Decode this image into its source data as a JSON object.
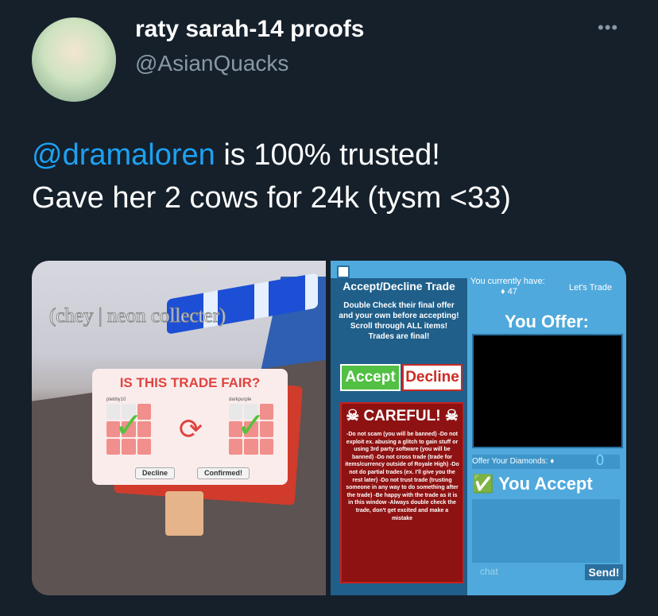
{
  "tweet": {
    "display_name": "raty sarah-14 proofs",
    "handle": "@AsianQuacks",
    "more_icon": "•••",
    "mention": "@dramaloren",
    "text_after_mention": " is 100% trusted!",
    "line2": "Gave her 2 cows for 24k (tysm <33)"
  },
  "media_left": {
    "watermark": "(chey | neon collecter)",
    "dialog_title": "IS THIS TRADE FAIR?",
    "user_left": "plebby10",
    "user_right": "darkpurple",
    "decline_label": "Decline",
    "confirm_label": "Confirmed!"
  },
  "media_right": {
    "heading": "Accept/Decline Trade",
    "info": "Double Check their final offer and your own before accepting! Scroll through ALL items! Trades are final!",
    "accept_label": "Accept",
    "decline_label": "Decline",
    "careful_title": "CAREFUL!",
    "rules": "-Do not scam (you will be banned) -Do not exploit ex. abusing a glitch to gain stuff or using 3rd party software (you will be banned) -Do not cross trade (trade for items/currency outside of Royale High) -Do not do partial trades (ex. I'll give you the rest later) -Do not trust trade (trusting someone in any way to do something after the trade) -Be happy with the trade as it is in this window -Always double check the trade, don't get excited and make a mistake",
    "currently_have": "You currently have:",
    "diamond_count": "47",
    "lets_trade": "Let's Trade",
    "you_offer": "You Offer:",
    "offer_diamonds_label": "Offer Your Diamonds:",
    "offer_diamonds_value": "0",
    "you_accept": "You Accept",
    "chat_placeholder": "chat",
    "send_label": "Send!"
  }
}
